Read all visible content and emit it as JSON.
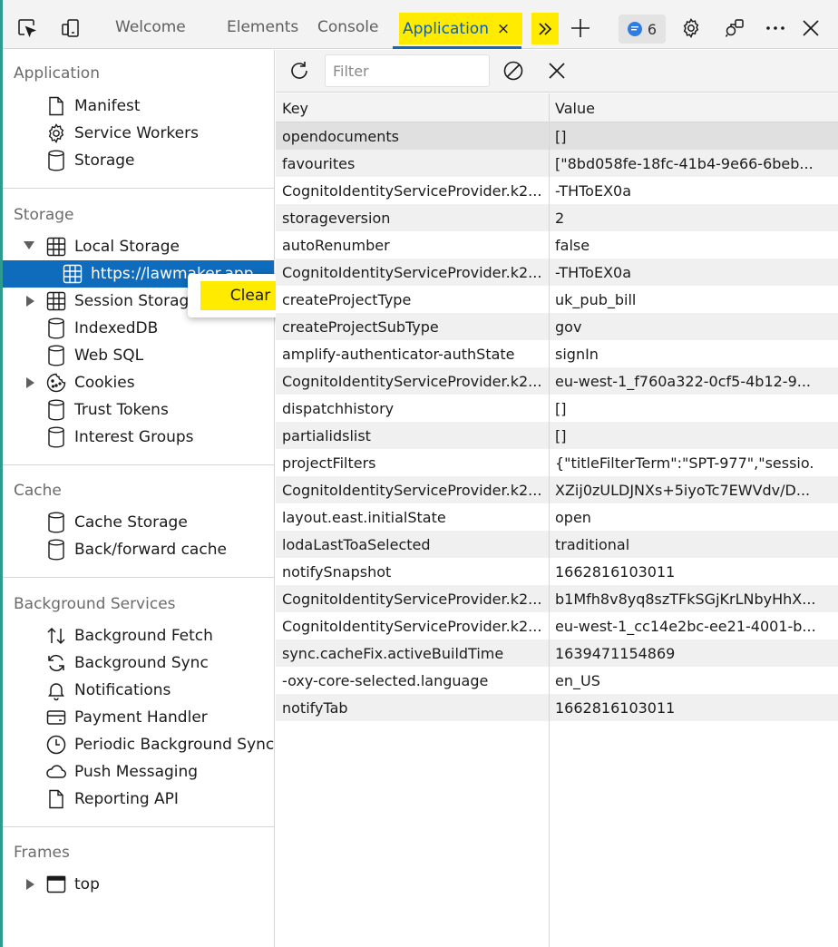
{
  "tabs": {
    "items": [
      {
        "label": "Welcome"
      },
      {
        "label": "Elements"
      },
      {
        "label": "Console"
      }
    ],
    "active": {
      "label": "Application",
      "close_glyph": "×"
    },
    "issues_count": "6"
  },
  "sidebar": {
    "application": {
      "title": "Application",
      "items": [
        {
          "label": "Manifest",
          "icon": "document-icon"
        },
        {
          "label": "Service Workers",
          "icon": "gear-icon"
        },
        {
          "label": "Storage",
          "icon": "database-icon"
        }
      ]
    },
    "storage": {
      "title": "Storage",
      "local_storage": {
        "label": "Local Storage"
      },
      "local_child": {
        "label": "https://lawmaker.app"
      },
      "items": [
        {
          "label": "Session Storage",
          "icon": "table-icon"
        },
        {
          "label": "IndexedDB",
          "icon": "database-icon"
        },
        {
          "label": "Web SQL",
          "icon": "database-icon"
        },
        {
          "label": "Cookies",
          "icon": "cookie-icon"
        },
        {
          "label": "Trust Tokens",
          "icon": "database-icon"
        },
        {
          "label": "Interest Groups",
          "icon": "database-icon"
        }
      ]
    },
    "cache": {
      "title": "Cache",
      "items": [
        {
          "label": "Cache Storage",
          "icon": "database-icon"
        },
        {
          "label": "Back/forward cache",
          "icon": "database-icon"
        }
      ]
    },
    "background": {
      "title": "Background Services",
      "items": [
        {
          "label": "Background Fetch",
          "icon": "arrows-updown-icon"
        },
        {
          "label": "Background Sync",
          "icon": "sync-icon"
        },
        {
          "label": "Notifications",
          "icon": "bell-icon"
        },
        {
          "label": "Payment Handler",
          "icon": "card-icon"
        },
        {
          "label": "Periodic Background Sync",
          "icon": "clock-icon"
        },
        {
          "label": "Push Messaging",
          "icon": "cloud-icon"
        },
        {
          "label": "Reporting API",
          "icon": "document-icon"
        }
      ]
    },
    "frames": {
      "title": "Frames",
      "top": {
        "label": "top"
      }
    }
  },
  "context_menu": {
    "clear_label": "Clear"
  },
  "toolbar": {
    "filter_placeholder": "Filter"
  },
  "table": {
    "headers": {
      "key": "Key",
      "value": "Value"
    },
    "rows": [
      {
        "key": "opendocuments",
        "value": "[]"
      },
      {
        "key": "favourites",
        "value": "[\"8bd058fe-18fc-41b4-9e66-6beb..."
      },
      {
        "key": "CognitoIdentityServiceProvider.k2...",
        "value": "-THToEX0a"
      },
      {
        "key": "storageversion",
        "value": "2"
      },
      {
        "key": "autoRenumber",
        "value": "false"
      },
      {
        "key": "CognitoIdentityServiceProvider.k2...",
        "value": "-THToEX0a"
      },
      {
        "key": "createProjectType",
        "value": "uk_pub_bill"
      },
      {
        "key": "createProjectSubType",
        "value": "gov"
      },
      {
        "key": "amplify-authenticator-authState",
        "value": "signIn"
      },
      {
        "key": "CognitoIdentityServiceProvider.k2...",
        "value": "eu-west-1_f760a322-0cf5-4b12-9..."
      },
      {
        "key": "dispatchhistory",
        "value": "[]"
      },
      {
        "key": "partialidslist",
        "value": "[]"
      },
      {
        "key": "projectFilters",
        "value": "{\"titleFilterTerm\":\"SPT-977\",\"sessio..."
      },
      {
        "key": "CognitoIdentityServiceProvider.k2...",
        "value": "XZij0zULDJNXs+5iyoTc7EWVdv/D..."
      },
      {
        "key": "layout.east.initialState",
        "value": "open"
      },
      {
        "key": "lodaLastToaSelected",
        "value": "traditional"
      },
      {
        "key": "notifySnapshot",
        "value": "1662816103011"
      },
      {
        "key": "CognitoIdentityServiceProvider.k2...",
        "value": "b1Mfh8v8yq8szTFkSGjKrLNbyHhX..."
      },
      {
        "key": "CognitoIdentityServiceProvider.k2...",
        "value": "eu-west-1_cc14e2bc-ee21-4001-b..."
      },
      {
        "key": "sync.cacheFix.activeBuildTime",
        "value": "1639471154869"
      },
      {
        "key": "-oxy-core-selected.language",
        "value": "en_US"
      },
      {
        "key": "notifyTab",
        "value": "1662816103011"
      }
    ]
  }
}
